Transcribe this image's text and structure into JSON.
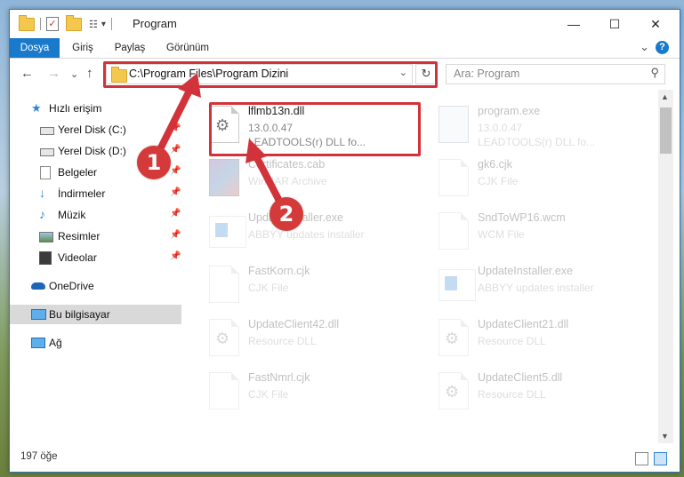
{
  "window": {
    "title": "Program",
    "minimize_glyph": "—",
    "maximize_glyph": "☐",
    "close_glyph": "✕"
  },
  "quick_access_toolbar": {
    "dropdown_glyph": "▾"
  },
  "ribbon": {
    "tabs": [
      "Dosya",
      "Giriş",
      "Paylaş",
      "Görünüm"
    ],
    "expand_glyph": "⌄",
    "help_glyph": "?"
  },
  "nav": {
    "back_glyph": "←",
    "forward_glyph": "→",
    "recent_glyph": "⌄",
    "up_glyph": "↑",
    "address": "C:\\Program Files\\Program Dizini",
    "address_dropdown_glyph": "⌄",
    "refresh_glyph": "↻",
    "search_placeholder": "Ara: Program",
    "search_glyph": "⚲"
  },
  "sidebar": {
    "items": [
      {
        "label": "Hızlı erişim",
        "icon": "star-icon"
      },
      {
        "label": "Yerel Disk (C:)",
        "icon": "drive-icon"
      },
      {
        "label": "Yerel Disk (D:)",
        "icon": "drive-icon"
      },
      {
        "label": "Belgeler",
        "icon": "documents-icon"
      },
      {
        "label": "İndirmeler",
        "icon": "download-icon"
      },
      {
        "label": "Müzik",
        "icon": "music-icon"
      },
      {
        "label": "Resimler",
        "icon": "pictures-icon"
      },
      {
        "label": "Videolar",
        "icon": "video-icon"
      },
      {
        "label": "OneDrive",
        "icon": "cloud-icon"
      },
      {
        "label": "Bu bilgisayar",
        "icon": "computer-icon"
      },
      {
        "label": "Ağ",
        "icon": "network-icon"
      }
    ],
    "pin_glyph": "📌"
  },
  "files": {
    "left": [
      {
        "name": "lflmb13n.dll",
        "line2": "13.0.0.47",
        "line3": "LEADTOOLS(r) DLL fo..."
      },
      {
        "name": "Certificates.cab",
        "line2": "WinRAR Archive"
      },
      {
        "name": "UpdateInstaller.exe",
        "line2": "ABBYY updates installer"
      },
      {
        "name": "FastKorn.cjk",
        "line2": "CJK File"
      },
      {
        "name": "UpdateClient42.dll",
        "line2": "Resource DLL"
      },
      {
        "name": "FastNmrl.cjk",
        "line2": "CJK File"
      }
    ],
    "right": [
      {
        "name": "program.exe",
        "line2": "13.0.0.47",
        "line3": "LEADTOOLS(r) DLL fo..."
      },
      {
        "name": "gk6.cjk",
        "line2": "CJK File"
      },
      {
        "name": "SndToWP16.wcm",
        "line2": "WCM File"
      },
      {
        "name": "UpdateInstaller.exe",
        "line2": "ABBYY updates installer"
      },
      {
        "name": "UpdateClient21.dll",
        "line2": "Resource DLL"
      },
      {
        "name": "UpdateClient5.dll",
        "line2": "Resource DLL"
      }
    ]
  },
  "status": {
    "item_count": "197 öğe"
  },
  "annotations": {
    "step1": "1",
    "step2": "2"
  },
  "colors": {
    "accent": "#1979ca",
    "highlight": "#d2333a"
  }
}
